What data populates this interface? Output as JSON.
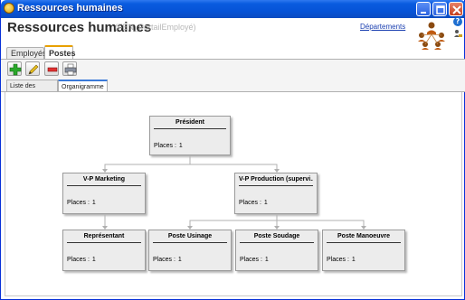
{
  "window": {
    "title": "Ressources humaines",
    "buttons": {
      "minimize": "minimize-icon",
      "maximize": "maximize-icon",
      "close": "close-icon"
    }
  },
  "header": {
    "title": "Ressources humaines",
    "subtitle": "(FEN_PortailEmployé)",
    "departments_link": "Départements",
    "logo_icon": "org-people-icon",
    "help_icon": "help-icon",
    "user_icon": "user-lock-icon"
  },
  "tabs": [
    {
      "label": "Employés",
      "active": false
    },
    {
      "label": "Postes",
      "active": true
    }
  ],
  "toolbar": {
    "add": "add-icon",
    "edit": "edit-pencil-icon",
    "delete": "delete-icon",
    "print": "print-icon"
  },
  "subtabs": [
    {
      "label": "Liste des postes",
      "active": false
    },
    {
      "label": "Organigramme",
      "active": true
    }
  ],
  "orgchart": {
    "places_label": "Places :",
    "nodes": {
      "president": {
        "title": "Président",
        "places": "1"
      },
      "vp_marketing": {
        "title": "V-P Marketing",
        "places": "1"
      },
      "vp_production": {
        "title": "V-P Production (supervi...",
        "places": "1"
      },
      "representant": {
        "title": "Représentant",
        "places": "1"
      },
      "poste_usinage": {
        "title": "Poste Usinage",
        "places": "1"
      },
      "poste_soudage": {
        "title": "Poste Soudage",
        "places": "1"
      },
      "poste_manoeuvre": {
        "title": "Poste Manoeuvre",
        "places": "1"
      }
    }
  },
  "colors": {
    "titlebar": "#0654d8",
    "tab_accent": "#e8a000",
    "subtab_accent": "#3a7ad8",
    "link": "#1a3fb0",
    "node_bg": "#ececec"
  }
}
